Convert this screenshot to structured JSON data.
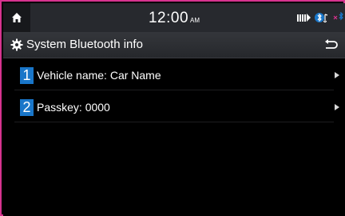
{
  "status": {
    "time": "12:00",
    "ampm": "AM",
    "icons": [
      "home-icon",
      "signal-bars-icon",
      "bluetooth-audio-icon",
      "bluetooth-icon"
    ]
  },
  "header": {
    "title": "System Bluetooth info",
    "title_icon": "gear-icon",
    "back_icon": "back-arrow-icon"
  },
  "items": [
    {
      "number": "1",
      "label": "Vehicle name: Car Name"
    },
    {
      "number": "2",
      "label": "Passkey: 0000"
    }
  ],
  "colors": {
    "frame_border": "#d6338f",
    "badge": "#1976c9",
    "statusbar": "#27292e",
    "background": "#000000"
  }
}
